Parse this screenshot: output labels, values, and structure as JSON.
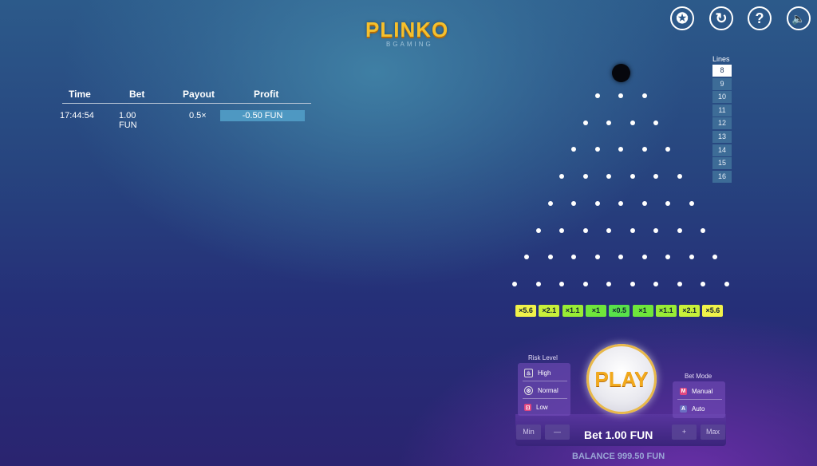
{
  "logo": {
    "title": "PLINKO",
    "subtitle": "BGAMING"
  },
  "top_icons": [
    {
      "name": "achievements-icon",
      "glyph": "✪"
    },
    {
      "name": "history-icon",
      "glyph": "↻"
    },
    {
      "name": "help-icon",
      "glyph": "?"
    },
    {
      "name": "sound-icon",
      "glyph": "🔈"
    }
  ],
  "history": {
    "headers": {
      "time": "Time",
      "bet": "Bet",
      "payout": "Payout",
      "profit": "Profit"
    },
    "rows": [
      {
        "time": "17:44:54",
        "bet": "1.00 FUN",
        "payout": "0.5×",
        "profit": "-0.50 FUN"
      }
    ]
  },
  "lines": {
    "label": "Lines",
    "options": [
      "8",
      "9",
      "10",
      "11",
      "12",
      "13",
      "14",
      "15",
      "16"
    ],
    "selected": "8"
  },
  "multipliers": [
    {
      "label": "×5.6",
      "color": "#f1f24a"
    },
    {
      "label": "×2.1",
      "color": "#c8f03a"
    },
    {
      "label": "×1.1",
      "color": "#99ec35"
    },
    {
      "label": "×1",
      "color": "#6fe63b"
    },
    {
      "label": "×0.5",
      "color": "#58e14a"
    },
    {
      "label": "×1",
      "color": "#6fe63b"
    },
    {
      "label": "×1.1",
      "color": "#99ec35"
    },
    {
      "label": "×2.1",
      "color": "#c8f03a"
    },
    {
      "label": "×5.6",
      "color": "#f1f24a"
    }
  ],
  "risk": {
    "title": "Risk Level",
    "options": [
      {
        "label": "High",
        "icon": "flame-icon"
      },
      {
        "label": "Normal",
        "icon": "gear-icon"
      },
      {
        "label": "Low",
        "icon": "lock-icon"
      }
    ]
  },
  "bet_mode": {
    "title": "Bet Mode",
    "options": [
      {
        "label": "Manual",
        "key": "M",
        "color": "#e0467f"
      },
      {
        "label": "Auto",
        "key": "A",
        "color": "#6b6fc2"
      }
    ]
  },
  "play_label": "PLAY",
  "bet": {
    "text": "Bet 1.00 FUN",
    "min": "Min",
    "minus": "—",
    "plus": "+",
    "max": "Max"
  },
  "balance": "BALANCE 999.50 FUN"
}
